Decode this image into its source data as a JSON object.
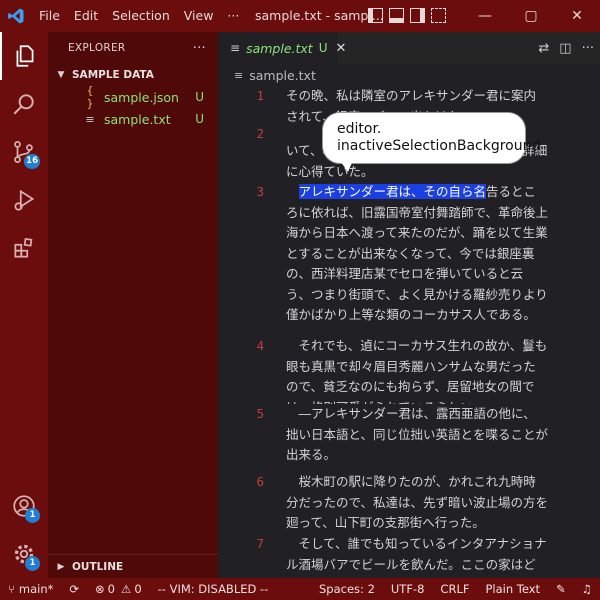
{
  "titlebar": {
    "menu": [
      "File",
      "Edit",
      "Selection",
      "View",
      "···"
    ],
    "title": "sample.txt - sampl...",
    "controls": [
      "—",
      "▢",
      "✕"
    ]
  },
  "activitybar": {
    "items": [
      {
        "name": "files-icon",
        "badge": ""
      },
      {
        "name": "search-icon",
        "badge": ""
      },
      {
        "name": "source-control-icon",
        "badge": "16"
      },
      {
        "name": "run-debug-icon",
        "badge": ""
      },
      {
        "name": "extensions-icon",
        "badge": ""
      }
    ],
    "bottom": [
      {
        "name": "account-icon",
        "badge": "1"
      },
      {
        "name": "settings-gear-icon",
        "badge": "1"
      }
    ]
  },
  "sidebar": {
    "header": "EXPLORER",
    "more": "···",
    "section": "SAMPLE DATA",
    "files": [
      {
        "icon": "{ }",
        "name": "sample.json",
        "status": "U"
      },
      {
        "icon": "≡",
        "name": "sample.txt",
        "status": "U"
      }
    ],
    "outline": "OUTLINE"
  },
  "editor": {
    "tab": {
      "name": "sample.txt",
      "status": "U",
      "close": "✕"
    },
    "breadcrumb": "sample.txt",
    "lines": [
      {
        "n": "1",
        "text": "その晩、私は隣室のアレキサンダー君に案内されて、銀座のバーへ出かけた。"
      },
      {
        "n": "2",
        "text": "いて、私の知らない色々なことを私よりも詳細に心得ていた。"
      },
      {
        "n": "3",
        "sel": "アレキサンダー君は、その自ら名",
        "text": "告るところに依れば、旧露国帝室付舞踏師で、革命後上海から日本へ渡って来たのだが、踊を以て生業とすることが出来なくなって、今では銀座裏の、西洋料理店某でセロを弾いていると云う、つまり街頭で、よく見かける羅紗売りより僅かばかり上等な類のコーカサス人である。"
      },
      {
        "n": "4",
        "text": "　それでも、遉にコーカサス生れの故か、鬘も眼も真黒で却々眉目秀麗ハンサムな男だったので、貧乏なのにも拘らず、居留地女の間では、格別可愛がられているらしい。"
      },
      {
        "n": "5",
        "text": "　―アレキサンダー君は、露西亜語の他に、拙い日本語と、同じ位拙い英語とを喋ることが出来る。"
      },
      {
        "n": "6",
        "text": "　桜木町の駅に降りたのが、かれこれ九時時分だったので、私達は、先ず暗い波止場の方を廻って、山下町の支那街へ行った。"
      },
      {
        "n": "7",
        "text": "　そして、誰でも知っているインタアナショナル酒場バアでビールを飲んだ。ここの家はどう云う理由か、エビス・ビールを看板にし"
      }
    ]
  },
  "tooltip": {
    "text": "editor.\ninactiveSelectionBackground"
  },
  "statusbar": {
    "branch": "main*",
    "errors": "0",
    "warnings": "0",
    "vim": "-- VIM: DISABLED --",
    "spaces": "Spaces: 2",
    "encoding": "UTF-8",
    "eol": "CRLF",
    "language": "Plain Text"
  },
  "colors": {
    "accent": "#6b0d0d",
    "sidebar": "#4f0909",
    "selection": "#1b3fe0",
    "untracked": "#8ee07a",
    "badge": "#1f7fd4"
  }
}
